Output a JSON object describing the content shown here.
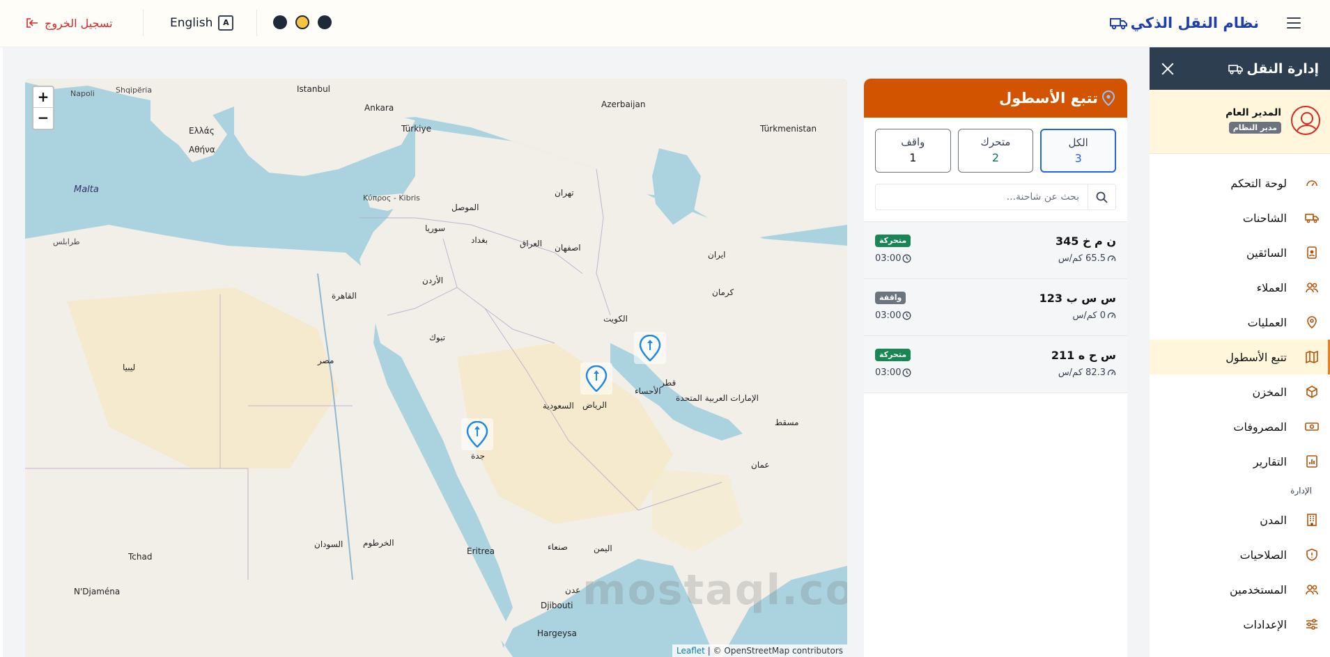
{
  "header": {
    "brand": "نظام النقل الذكي",
    "logout": "تسجيل الخروج",
    "language": "English",
    "lang_icon": "translate-icon",
    "theme_dots": [
      "dark",
      "yellow",
      "dark"
    ],
    "accent_color": "#1e40af"
  },
  "sidebar": {
    "title": "إدارة النقل",
    "user": {
      "name": "المدير العام",
      "role": "مدير النظام"
    },
    "items": [
      {
        "label": "لوحة التحكم",
        "icon": "dashboard-icon"
      },
      {
        "label": "الشاحنات",
        "icon": "truck-icon"
      },
      {
        "label": "السائقين",
        "icon": "id-badge-icon"
      },
      {
        "label": "العملاء",
        "icon": "users-icon"
      },
      {
        "label": "العمليات",
        "icon": "map-pin-icon"
      },
      {
        "label": "تتبع الأسطول",
        "icon": "map-icon",
        "active": true
      },
      {
        "label": "المخزن",
        "icon": "box-icon"
      },
      {
        "label": "المصروفات",
        "icon": "cash-icon"
      },
      {
        "label": "التقارير",
        "icon": "chart-icon"
      }
    ],
    "admin_section": "الإدارة",
    "admin_items": [
      {
        "label": "المدن",
        "icon": "building-icon"
      },
      {
        "label": "الصلاحيات",
        "icon": "shield-icon"
      },
      {
        "label": "المستخدمين",
        "icon": "users-icon"
      },
      {
        "label": "الإعدادات",
        "icon": "sliders-icon"
      }
    ],
    "active_color": "#e67e22"
  },
  "fleet": {
    "title": "تتبع الأسطول",
    "header_color": "#d35400",
    "stats": [
      {
        "label": "الكل",
        "value": "3"
      },
      {
        "label": "متحرك",
        "value": "2"
      },
      {
        "label": "واقف",
        "value": "1"
      }
    ],
    "search_placeholder": "بحث عن شاحنة...",
    "vehicles": [
      {
        "plate": "ن م خ 345",
        "speed": "65.5 كم/س",
        "status": "متحركة",
        "status_type": "moving",
        "time": "03:00"
      },
      {
        "plate": "س س ب 123",
        "speed": "0 كم/س",
        "status": "واقفة",
        "status_type": "stopped",
        "time": "03:00"
      },
      {
        "plate": "س ح ه 211",
        "speed": "82.3 كم/س",
        "status": "متحركة",
        "status_type": "moving",
        "time": "03:00"
      }
    ]
  },
  "map": {
    "zoom_in": "+",
    "zoom_out": "−",
    "attribution_link": "Leaflet",
    "attribution_text": "| © OpenStreetMap contributors",
    "watermark": "mostaql.com",
    "labels": {
      "tehran": "تهران",
      "baghdad": "بغداد",
      "kuwait": "الكويت",
      "riyadh": "الرياض",
      "jeddah": "جدة",
      "cairo": "القاهرة",
      "doha": "قطر",
      "uae": "الإمارات العربية المتحدة",
      "oman": "عمان",
      "yemen": "اليمن",
      "saudi": "السعودية",
      "iraq": "العراق",
      "iran": "ایران",
      "syria": "سوريا",
      "jordan": "الأردن",
      "egypt": "مصر",
      "sudan": "السودان",
      "libya": "ليبيا",
      "turkey": "Türkiye",
      "cyprus": "Κύπρος - Kibris",
      "malta": "Malta",
      "tripoli": "طرابلس",
      "muscat": "مسقط",
      "sanaa": "صنعاء",
      "aden": "عدن",
      "khartoum": "الخرطوم",
      "eritrea": "Eritrea",
      "djibouti": "Djibouti",
      "turkmenistan": "Türkmenistan",
      "azerbaijan": "Azerbaijan",
      "ankara": "Ankara",
      "istanbul": "Istanbul",
      "athens": "Αθήνα",
      "greece": "Ελλάς",
      "tchad": "Tchad",
      "ndjamena": "N'Djaména",
      "hofuf": "الأحساء",
      "tabuk": "تبوك",
      "mosul": "الموصل",
      "kerman": "کرمان",
      "isfahan": "اصفهان",
      "hargeysa": "Hargeysa"
    }
  }
}
